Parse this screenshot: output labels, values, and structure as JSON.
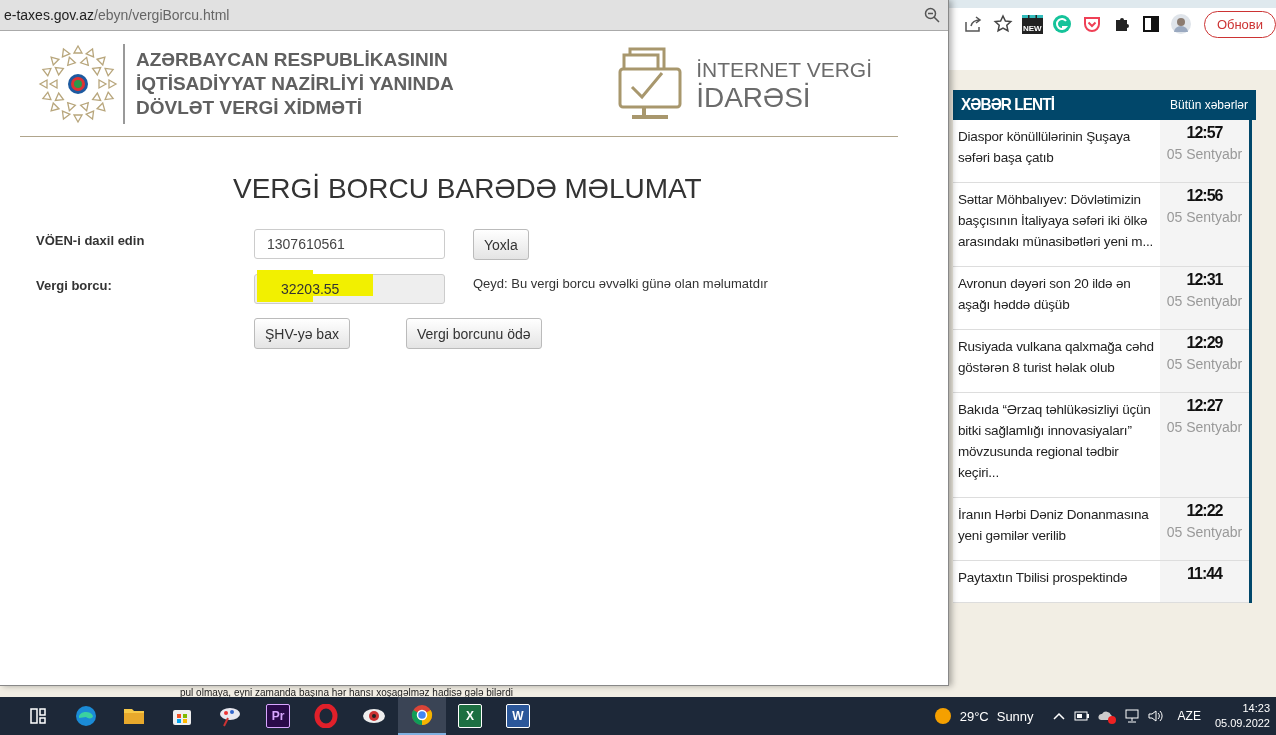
{
  "browser_toolbar": {
    "icons": [
      {
        "kind": "share"
      },
      {
        "kind": "star"
      },
      {
        "kind": "new",
        "glyph": "NEW"
      },
      {
        "kind": "grammarly"
      },
      {
        "kind": "pocket"
      },
      {
        "kind": "puzzle"
      },
      {
        "kind": "sidebar"
      },
      {
        "kind": "avatar"
      }
    ],
    "update_button": "Обнови"
  },
  "news": {
    "title": "XƏBƏR LENTİ",
    "all_link": "Bütün xəbərlər",
    "items": [
      {
        "headline": "Diaspor könüllülərinin Şuşaya səfəri başa çatıb",
        "time": "12:57",
        "date": "05 Sentyabr"
      },
      {
        "headline": "Səttar Möhbalıyev: Dövlətimizin başçısının İtaliyaya səfəri iki ölkə arasındakı münasibətləri yeni m...",
        "time": "12:56",
        "date": "05 Sentyabr"
      },
      {
        "headline": "Avronun dəyəri son 20 ildə ən aşağı həddə düşüb",
        "time": "12:31",
        "date": "05 Sentyabr"
      },
      {
        "headline": "Rusiyada vulkana qalxmağa cəhd göstərən 8 turist həlak olub",
        "time": "12:29",
        "date": "05 Sentyabr"
      },
      {
        "headline": "Bakıda “Ərzaq təhlükəsizliyi üçün bitki sağlamlığı innovasiyaları” mövzusunda regional tədbir keçiri...",
        "time": "12:27",
        "date": "05 Sentyabr"
      },
      {
        "headline": "İranın Hərbi Dəniz Donanmasına yeni gəmilər verilib",
        "time": "12:22",
        "date": "05 Sentyabr"
      },
      {
        "headline": "Paytaxtın Tbilisi prospektində",
        "time": "11:44"
      }
    ]
  },
  "background_text": "pul olmaya, eyni zamanda başına hər hansı xoşagəlməz hadisə gələ bilərdi",
  "popup": {
    "url_host": "e-taxes.gov.az",
    "url_path": "/ebyn/vergiBorcu.html",
    "org_lines": [
      "AZƏRBAYCAN RESPUBLİKASININ",
      "İQTİSADİYYAT NAZİRLİYİ YANINDA",
      "DÖVLƏT VERGİ XİDMƏTİ"
    ],
    "service_lines": [
      "İNTERNET VERGİ",
      "İDARƏSİ"
    ],
    "heading": "VERGİ BORCU BARƏDƏ MƏLUMAT",
    "voen_label": "VÖEN-i daxil edin",
    "voen_value": "1307610561",
    "check_button": "Yoxla",
    "debt_label": "Vergi borcu:",
    "debt_value": "32203.55",
    "debt_highlighted": true,
    "note": "Qeyd: Bu vergi borcu əvvəlki günə olan məlumatdır",
    "buttons": [
      "ŞHV-yə bax",
      "Vergi borcunu ödə"
    ]
  },
  "taskbar": {
    "apps": [
      {
        "kind": "widgets",
        "selected": false
      },
      {
        "kind": "edge",
        "selected": false
      },
      {
        "kind": "folder",
        "selected": false
      },
      {
        "kind": "store",
        "selected": false
      },
      {
        "kind": "paint",
        "selected": false
      },
      {
        "kind": "premiere",
        "glyph": "Pr",
        "selected": false
      },
      {
        "kind": "opera",
        "selected": false
      },
      {
        "kind": "eye",
        "selected": false
      },
      {
        "kind": "chrome",
        "selected": true
      },
      {
        "kind": "excel",
        "glyph": "X",
        "selected": false
      },
      {
        "kind": "word",
        "glyph": "W",
        "selected": false
      }
    ],
    "temperature": "29°C",
    "weather": "Sunny",
    "language": "AZE",
    "time": "14:23",
    "date": "05.09.2022"
  }
}
